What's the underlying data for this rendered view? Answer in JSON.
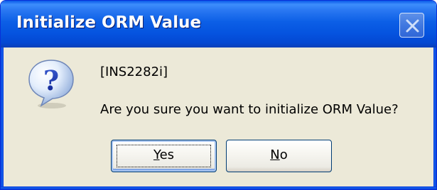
{
  "window": {
    "title": "Initialize ORM Value",
    "close_icon": "close-icon"
  },
  "dialog": {
    "icon": "question-icon",
    "code": "[INS2282i]",
    "message": "Are you sure you want to initialize ORM Value?"
  },
  "buttons": {
    "yes": {
      "accel": "Y",
      "rest": "es"
    },
    "no": {
      "accel": "N",
      "rest": "o"
    }
  },
  "colors": {
    "titlebar": "#0553df",
    "frame": "#0831d9",
    "dialog_bg": "#ece9d8",
    "button_border": "#003c74"
  }
}
